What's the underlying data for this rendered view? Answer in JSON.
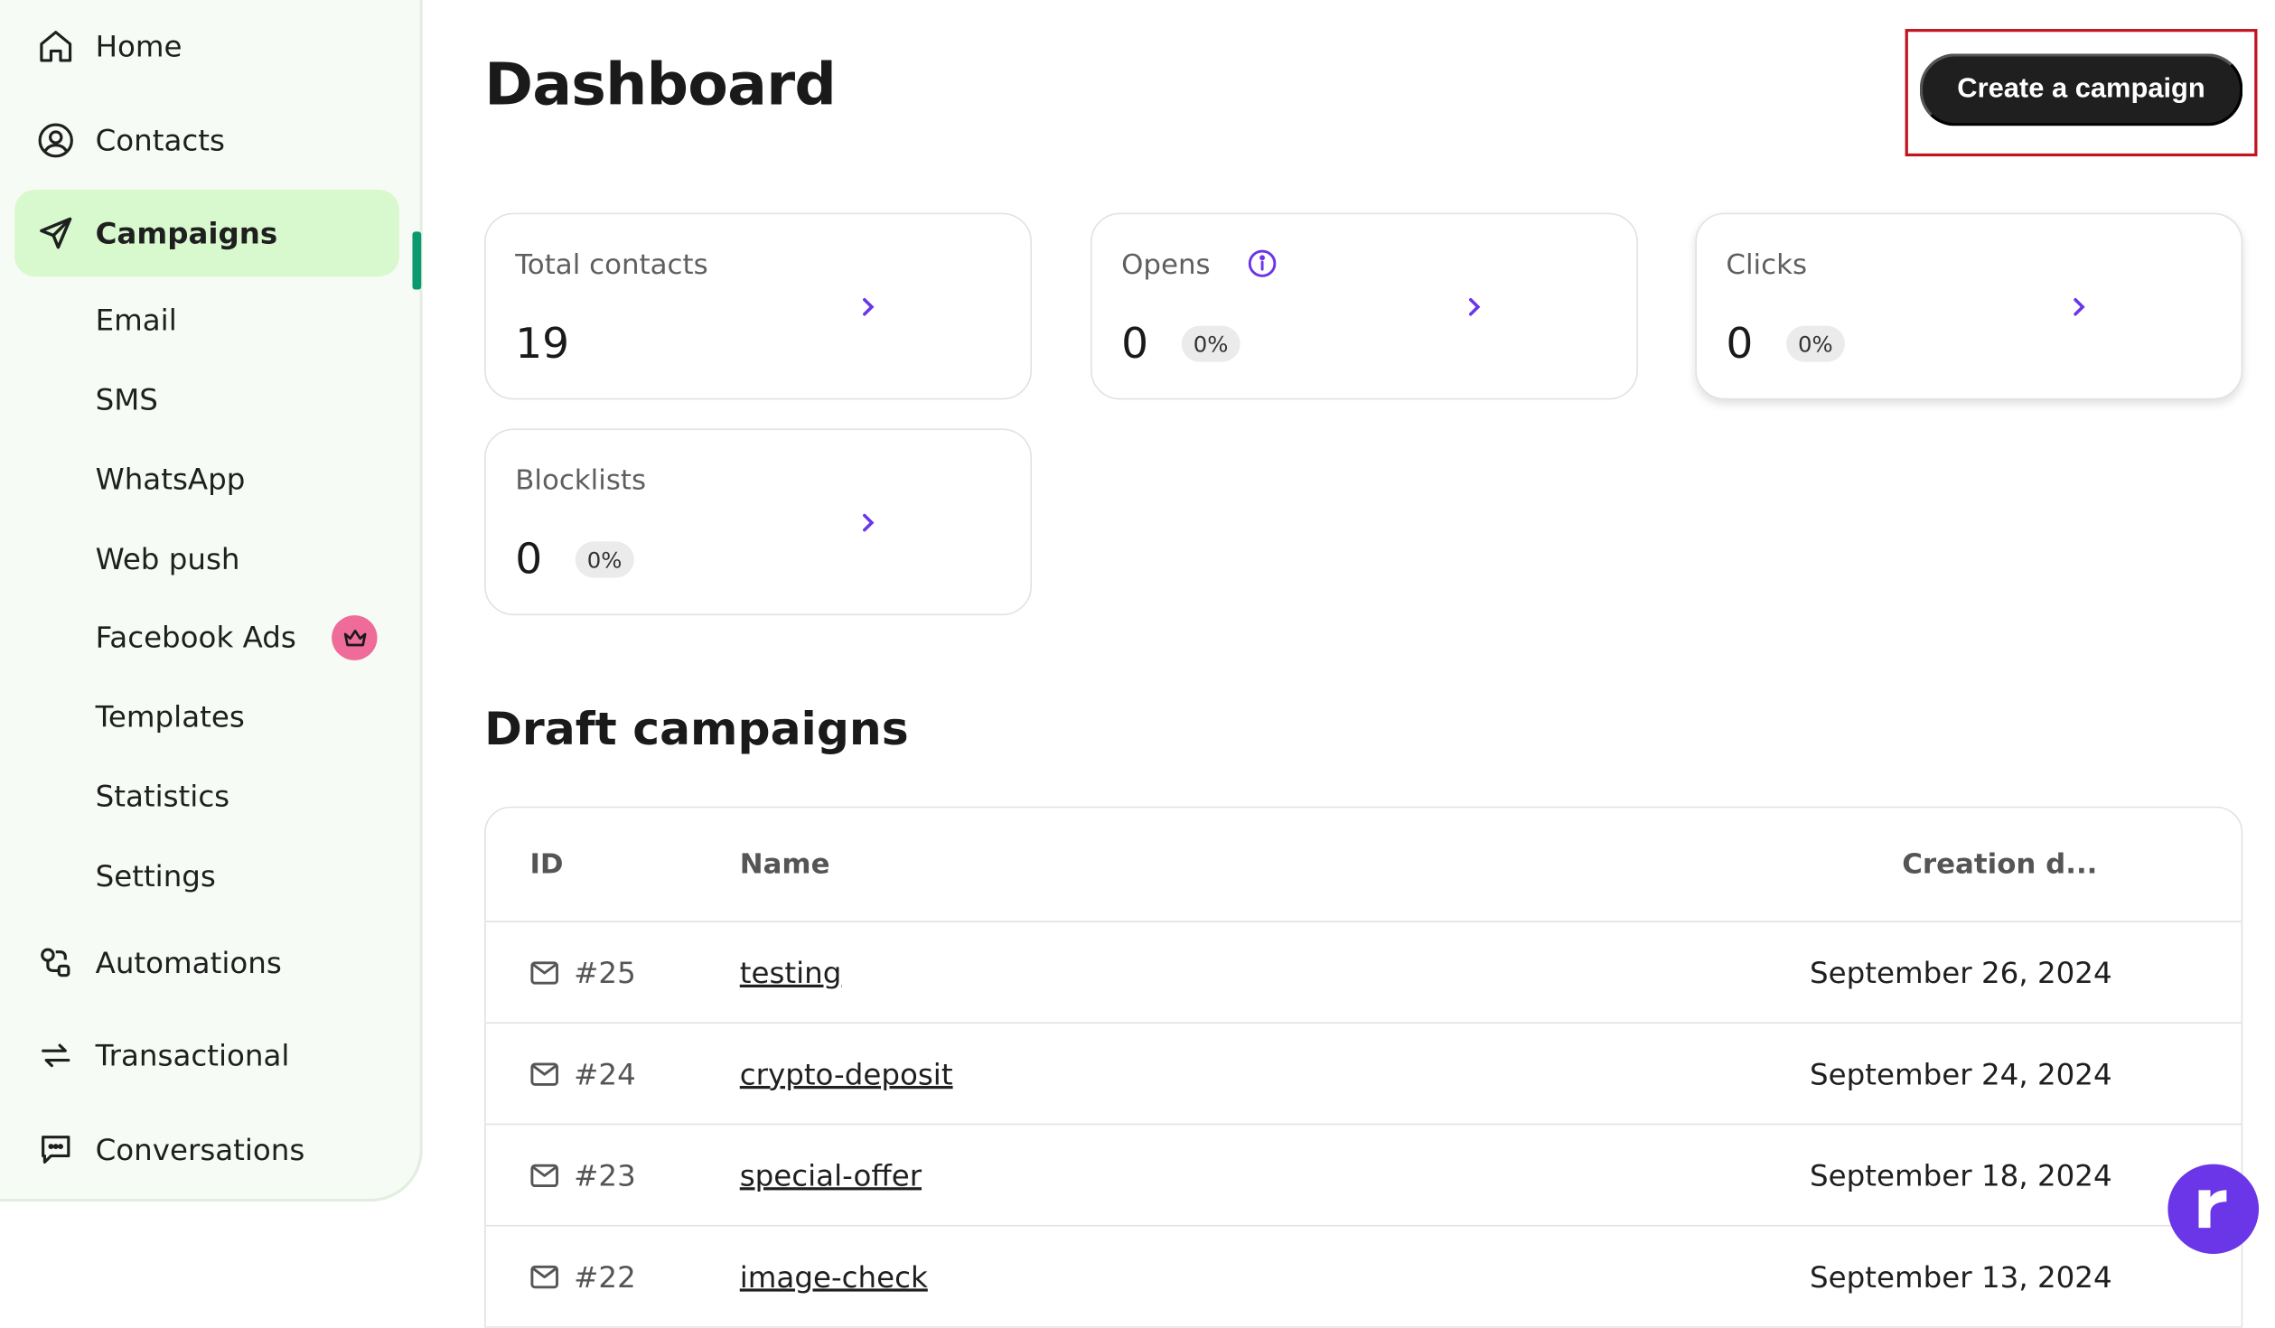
{
  "sidebar": {
    "items": [
      {
        "label": "Home",
        "icon": "home-icon"
      },
      {
        "label": "Contacts",
        "icon": "contacts-icon"
      },
      {
        "label": "Campaigns",
        "icon": "send-icon"
      },
      {
        "label": "Automations",
        "icon": "automations-icon"
      },
      {
        "label": "Transactional",
        "icon": "transactional-icon"
      },
      {
        "label": "Conversations",
        "icon": "conversations-icon"
      }
    ],
    "campaign_subitems": [
      {
        "label": "Email"
      },
      {
        "label": "SMS"
      },
      {
        "label": "WhatsApp"
      },
      {
        "label": "Web push"
      },
      {
        "label": "Facebook Ads",
        "badge_icon": "crown-icon"
      },
      {
        "label": "Templates"
      },
      {
        "label": "Statistics"
      },
      {
        "label": "Settings"
      }
    ],
    "active_item": "Campaigns",
    "active_color": "#d8f9cd",
    "marker_color": "#0b996e"
  },
  "header": {
    "title": "Dashboard",
    "create_button": "Create a campaign"
  },
  "stats": {
    "total_contacts": {
      "title": "Total contacts",
      "value": "19"
    },
    "opens": {
      "title": "Opens",
      "value": "0",
      "percent": "0%"
    },
    "clicks": {
      "title": "Clicks",
      "value": "0",
      "percent": "0%"
    },
    "blocklists": {
      "title": "Blocklists",
      "value": "0",
      "percent": "0%"
    }
  },
  "drafts": {
    "title": "Draft campaigns",
    "columns": [
      "ID",
      "Name",
      "Creation d..."
    ],
    "rows": [
      {
        "id": "#25",
        "name": "testing",
        "date": "September 26, 2024"
      },
      {
        "id": "#24",
        "name": "crypto-deposit",
        "date": "September 24, 2024"
      },
      {
        "id": "#23",
        "name": "special-offer",
        "date": "September 18, 2024"
      },
      {
        "id": "#22",
        "name": "image-check",
        "date": "September 13, 2024"
      }
    ]
  },
  "colors": {
    "accent_purple": "#6b35e8",
    "button_dark": "#1f1f1f",
    "highlight_red": "#c0151f"
  }
}
